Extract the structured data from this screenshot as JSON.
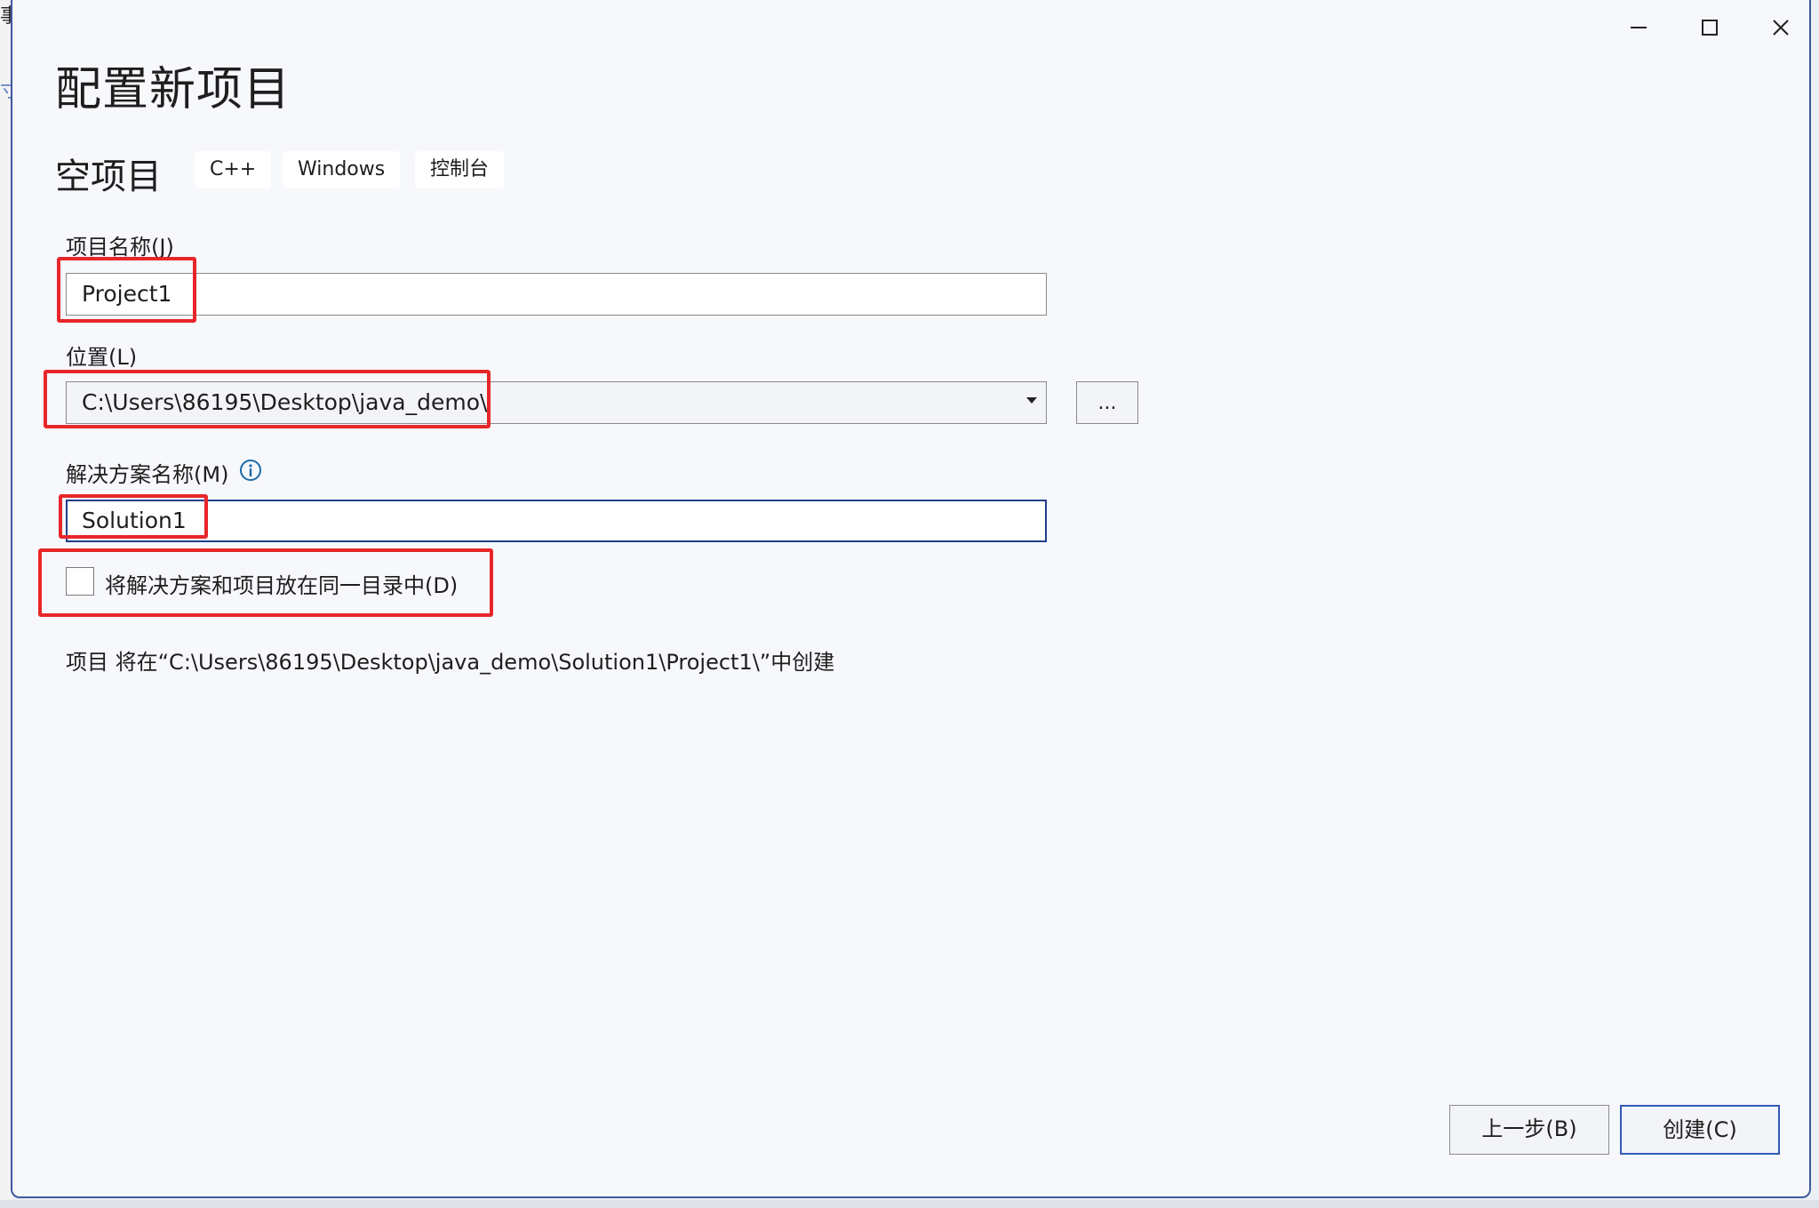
{
  "background": {
    "glyph_top": "事",
    "glyph_mid": "寸"
  },
  "window": {
    "title": "配置新项目",
    "controls": {
      "minimize": "minimize-icon",
      "maximize": "maximize-icon",
      "close": "close-icon"
    }
  },
  "template": {
    "name": "空项目",
    "tags": [
      "C++",
      "Windows",
      "控制台"
    ]
  },
  "form": {
    "project_name": {
      "label": "项目名称(J)",
      "value": "Project1"
    },
    "location": {
      "label": "位置(L)",
      "value": "C:\\Users\\86195\\Desktop\\java_demo\\",
      "browse_label": "..."
    },
    "solution_name": {
      "label": "解决方案名称(M)",
      "value": "Solution1",
      "info_icon": "info-icon"
    },
    "same_dir_checkbox": {
      "label": "将解决方案和项目放在同一目录中(D)",
      "checked": false
    },
    "result_text": "项目 将在“C:\\Users\\86195\\Desktop\\java_demo\\Solution1\\Project1\\”中创建"
  },
  "footer": {
    "back_label": "上一步(B)",
    "create_label": "创建(C)"
  },
  "colors": {
    "highlight": "#e8262a",
    "window_border": "#3d5a99",
    "focus_border": "#1f3f8c",
    "info_icon": "#1a6aa8"
  }
}
